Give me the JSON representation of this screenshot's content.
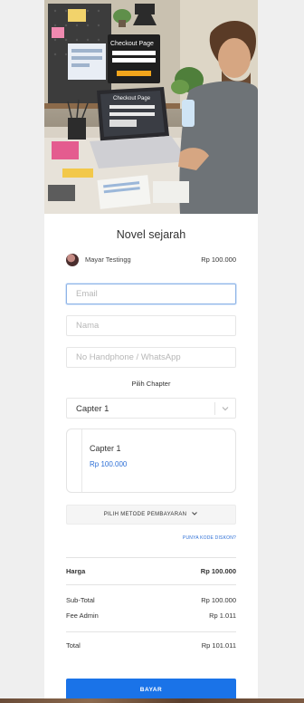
{
  "hero": {
    "screen_heading": "Checkout Page",
    "laptop_heading": "Checkout Page"
  },
  "product": {
    "title": "Novel sejarah"
  },
  "seller": {
    "name": "Mayar Testingg",
    "price": "Rp 100.000"
  },
  "form": {
    "email_placeholder": "Email",
    "name_placeholder": "Nama",
    "phone_placeholder": "No Handphone / WhatsApp"
  },
  "chapter": {
    "label": "Pilih Chapter",
    "selected": "Capter 1",
    "card_name": "Capter 1",
    "card_price": "Rp 100.000"
  },
  "payment": {
    "method_label": "PILIH METODE PEMBAYARAN",
    "discount_link": "PUNYA KODE DISKON?",
    "button_label": "BAYAR"
  },
  "summary": {
    "harga_label": "Harga",
    "harga_value": "Rp 100.000",
    "subtotal_label": "Sub-Total",
    "subtotal_value": "Rp 100.000",
    "fee_label": "Fee Admin",
    "fee_value": "Rp 1.011",
    "total_label": "Total",
    "total_value": "Rp 101.011"
  },
  "colors": {
    "accent": "#1a73e8",
    "link": "#2d6fd6"
  }
}
